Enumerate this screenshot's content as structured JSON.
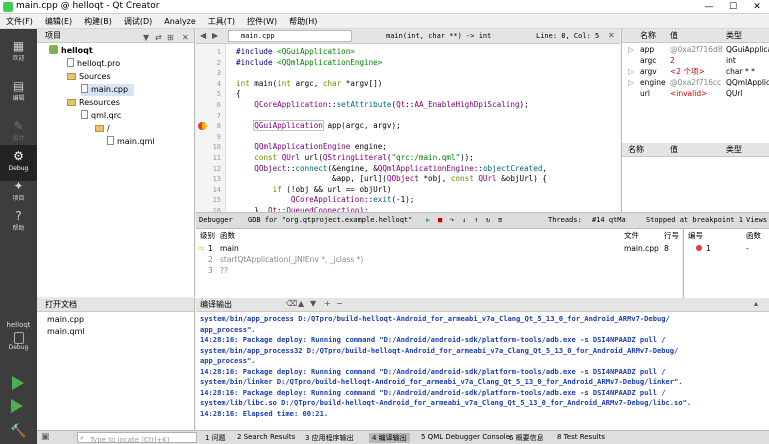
{
  "window": {
    "title": "main.cpp @ helloqt - Qt Creator",
    "minimize": "—",
    "maximize": "☐",
    "close": "✕"
  },
  "menu": [
    "文件(F)",
    "编辑(E)",
    "构建(B)",
    "调试(D)",
    "Analyze",
    "工具(T)",
    "控件(W)",
    "帮助(H)"
  ],
  "modes": [
    {
      "icon": "▦",
      "label": "欢迎"
    },
    {
      "icon": "▤",
      "label": "编辑"
    },
    {
      "icon": "✎",
      "label": "设计"
    },
    {
      "icon": "⚙",
      "label": "Debug"
    },
    {
      "icon": "✦",
      "label": "项目"
    },
    {
      "icon": "?",
      "label": "帮助"
    }
  ],
  "kit": {
    "project": "helloqt",
    "config": "Debug"
  },
  "project_pane": {
    "title": "项目",
    "tree": [
      "helloqt",
      "helloqt.pro",
      "Sources",
      "main.cpp",
      "Resources",
      "qml.qrc",
      "/",
      "main.qml"
    ]
  },
  "open_files": {
    "title": "打开文档",
    "files": [
      "main.cpp",
      "main.qml"
    ]
  },
  "editor": {
    "filename": "main.cpp",
    "function": "main(int, char **) -> int",
    "position": "Line: 8, Col: 5",
    "line_numbers": [
      "1",
      "2",
      "3",
      "4",
      "5",
      "6",
      "7",
      "8",
      "9",
      "10",
      "11",
      "12",
      "13",
      "14",
      "15",
      "16"
    ]
  },
  "locals": {
    "headers": [
      "名称",
      "值",
      "类型"
    ],
    "rows": [
      {
        "name": "app",
        "value": "@0xa2f716d8",
        "type": "QGuiApplica"
      },
      {
        "name": "argc",
        "value": "2",
        "type": "int"
      },
      {
        "name": "argv",
        "value": "<2 个项>",
        "type": "char * *"
      },
      {
        "name": "engine",
        "value": "@0xa2f716cc",
        "type": "QQmlApplica"
      },
      {
        "name": "url",
        "value": "<invalid>",
        "type": "QUrl"
      }
    ]
  },
  "watches": {
    "headers": [
      "名称",
      "值",
      "类型"
    ]
  },
  "debug_toolbar": {
    "debugger": "Debugger",
    "gdb": "GDB for \"org.qtproject.example.helloqt\"",
    "threads": "Threads:",
    "thread": "#14 qtMa",
    "status": "Stopped at breakpoint 1",
    "views": "Views"
  },
  "stack": {
    "headers": [
      "级别",
      "函数",
      "文件",
      "行号"
    ],
    "rows": [
      {
        "level": "1",
        "function": "main",
        "file": "main.cpp",
        "line": "8"
      },
      {
        "level": "2",
        "function": "startQtApplication(_JNIEnv *, _jclass *)",
        "file": "",
        "line": ""
      },
      {
        "level": "3",
        "function": "??",
        "file": "",
        "line": ""
      }
    ]
  },
  "breakpoints": {
    "headers": [
      "编号",
      "函数"
    ],
    "rows": [
      {
        "num": "1",
        "func": "-"
      }
    ]
  },
  "output": {
    "title": "编译输出",
    "lines": [
      "system/bin/app_process D:/QTpro/build-helloqt-Android_for_armeabi_v7a_Clang_Qt_5_13_0_for_Android_ARMv7-Debug/",
      "app_process\".",
      "14:28:16: Package deploy: Running command \"D:/Android/android-sdk/platform-tools/adb.exe -s DSI4NPAADZ pull /",
      "system/bin/app_process32 D:/QTpro/build-helloqt-Android_for_armeabi_v7a_Clang_Qt_5_13_0_for_Android_ARMv7-Debug/",
      "app_process\".",
      "14:28:16: Package deploy: Running command \"D:/Android/android-sdk/platform-tools/adb.exe -s DSI4NPAADZ pull /",
      "system/bin/linker D:/QTpro/build-helloqt-Android_for_armeabi_v7a_Clang_Qt_5_13_0_for_Android_ARMv7-Debug/linker\".",
      "14:28:16: Package deploy: Running command \"D:/Android/android-sdk/platform-tools/adb.exe -s DSI4NPAADZ pull /",
      "system/lib/libc.so D:/QTpro/build-helloqt-Android_for_armeabi_v7a_Clang_Qt_5_13_0_for_Android_ARMv7-Debug/libc.so\".",
      "14:28:16: Elapsed time: 00:21."
    ]
  },
  "status_bar": {
    "locate_placeholder": "Type to locate (Ctrl+K)",
    "tabs": [
      "1 问题",
      "2 Search Results",
      "3 应用程序输出",
      "4 编译输出",
      "5 QML Debugger Console",
      "6 概要信息",
      "8 Test Results"
    ]
  }
}
